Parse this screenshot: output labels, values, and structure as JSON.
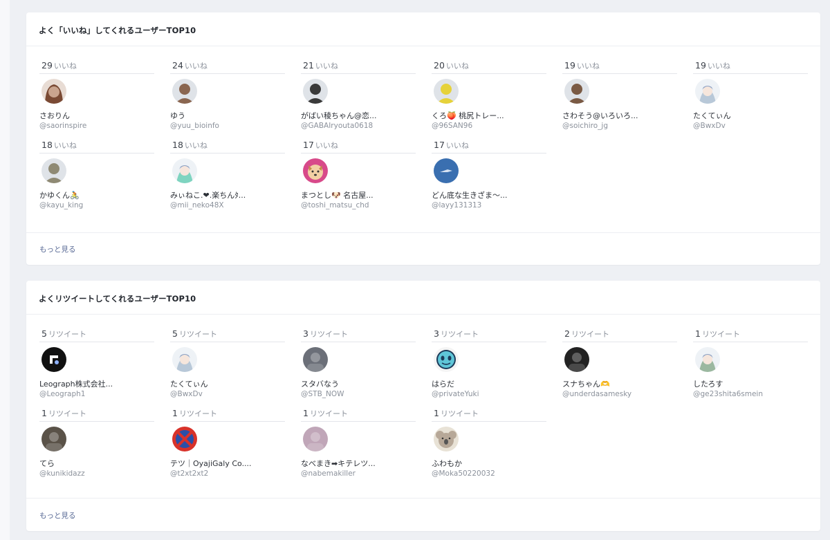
{
  "likes_section": {
    "title": "よく「いいね」してくれるユーザーTOP10",
    "unit": "いいね",
    "more_label": "もっと見る",
    "users": [
      {
        "count": "29",
        "name": "さおりん",
        "handle": "@saorinspire",
        "avatar": "woman-icon",
        "color": "#c9a48e"
      },
      {
        "count": "24",
        "name": "ゆう",
        "handle": "@yuu_bioinfo",
        "avatar": "man-icon",
        "color": "#8a6650"
      },
      {
        "count": "21",
        "name": "がばい稜ちゃん@恋...",
        "handle": "@GABAIryouta0618",
        "avatar": "man-icon",
        "color": "#3a3a3a"
      },
      {
        "count": "20",
        "name": "くろ🍑 桃尻トレー...",
        "handle": "@96SAN96",
        "avatar": "man-icon",
        "color": "#e6d23a"
      },
      {
        "count": "19",
        "name": "さわそう@いろいろ...",
        "handle": "@soichiro_jg",
        "avatar": "man-icon",
        "color": "#7a5a44"
      },
      {
        "count": "19",
        "name": "たくてぃん",
        "handle": "@BwxDv",
        "avatar": "anime-icon",
        "color": "#b8c8d8"
      },
      {
        "count": "18",
        "name": "かゆくん🚴",
        "handle": "@kayu_king",
        "avatar": "man-icon",
        "color": "#8f8a74"
      },
      {
        "count": "18",
        "name": "みぃねこ.❤︎.楽ちんﾀ...",
        "handle": "@mii_neko48X",
        "avatar": "anime-icon",
        "color": "#7fd4c0"
      },
      {
        "count": "17",
        "name": "まつとし🐶 名古屋...",
        "handle": "@toshi_matsu_chd",
        "avatar": "dog-icon",
        "color": "#d84a8a"
      },
      {
        "count": "17",
        "name": "どん底な生きざま〜...",
        "handle": "@layy131313",
        "avatar": "bird-icon",
        "color": "#3a6fb0"
      }
    ]
  },
  "retweets_section": {
    "title": "よくリツイートしてくれるユーザーTOP10",
    "unit": "リツイート",
    "more_label": "もっと見る",
    "users": [
      {
        "count": "5",
        "name": "Leograph株式会社...",
        "handle": "@Leograph1",
        "avatar": "logo-icon",
        "color": "#111111"
      },
      {
        "count": "5",
        "name": "たくてぃん",
        "handle": "@BwxDv",
        "avatar": "anime-icon",
        "color": "#b8c8d8"
      },
      {
        "count": "3",
        "name": "スタバなう",
        "handle": "@STB_NOW",
        "avatar": "photo-icon",
        "color": "#6b6f78"
      },
      {
        "count": "3",
        "name": "はらだ",
        "handle": "@privateYuki",
        "avatar": "face-icon",
        "color": "#5fc6d8"
      },
      {
        "count": "2",
        "name": "スナちゃん🫶",
        "handle": "@underdasamesky",
        "avatar": "photo-icon",
        "color": "#222222"
      },
      {
        "count": "1",
        "name": "したろす",
        "handle": "@ge23shita6smein",
        "avatar": "anime-icon",
        "color": "#9bb8a0"
      },
      {
        "count": "1",
        "name": "てら",
        "handle": "@kunikidazz",
        "avatar": "photo-icon",
        "color": "#5a5248"
      },
      {
        "count": "1",
        "name": "テツ｜OyajiGaly Co....",
        "handle": "@t2xt2xt2",
        "avatar": "no-parking-icon",
        "color": "#2a4fa8"
      },
      {
        "count": "1",
        "name": "なべまき➡︎キテレツ...",
        "handle": "@nabemakiller",
        "avatar": "photo-icon",
        "color": "#c0a6b8"
      },
      {
        "count": "1",
        "name": "ふわもか",
        "handle": "@Moka50220032",
        "avatar": "koala-icon",
        "color": "#b7a898"
      }
    ]
  }
}
